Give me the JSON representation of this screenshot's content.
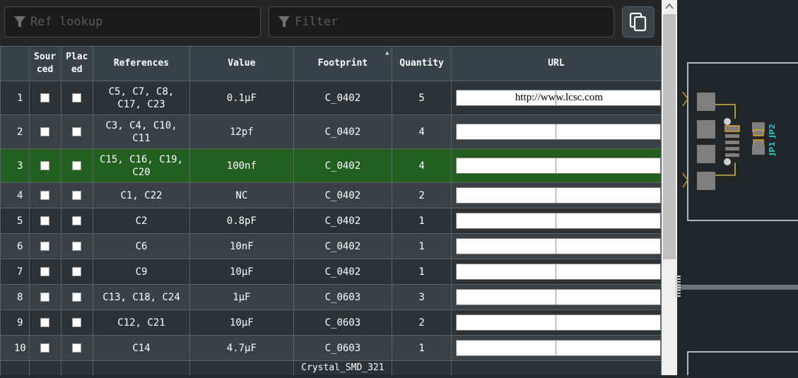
{
  "filters": {
    "ref_lookup_placeholder": "Ref lookup",
    "filter_placeholder": "Filter"
  },
  "toolbar": {
    "copy_icon": "copy-icon",
    "filter_icon": "funnel-icon"
  },
  "table": {
    "columns": [
      "",
      "Sourced",
      "Placed",
      "References",
      "Value",
      "Footprint",
      "Quantity",
      "URL"
    ],
    "header_labels": {
      "sourced": "Sour\nced",
      "placed": "Plac\ned",
      "references": "References",
      "value": "Value",
      "footprint": "Footprint",
      "quantity": "Quantity",
      "url": "URL"
    },
    "sorted_column": "Footprint",
    "rows": [
      {
        "num": "1",
        "refs": "C5, C7, C8,\nC17, C23",
        "value": "0.1µF",
        "footprint": "C_0402",
        "qty": "5",
        "url": "http://www.lcsc.com",
        "sourced": false,
        "placed": false
      },
      {
        "num": "2",
        "refs": "C3, C4, C10,\nC11",
        "value": "12pf",
        "footprint": "C_0402",
        "qty": "4",
        "url": "",
        "sourced": false,
        "placed": false
      },
      {
        "num": "3",
        "refs": "C15, C16, C19,\nC20",
        "value": "100nf",
        "footprint": "C_0402",
        "qty": "4",
        "url": "",
        "sourced": false,
        "placed": false,
        "highlighted": true
      },
      {
        "num": "4",
        "refs": "C1, C22",
        "value": "NC",
        "footprint": "C_0402",
        "qty": "2",
        "url": "",
        "sourced": false,
        "placed": false
      },
      {
        "num": "5",
        "refs": "C2",
        "value": "0.8pF",
        "footprint": "C_0402",
        "qty": "1",
        "url": "",
        "sourced": false,
        "placed": false
      },
      {
        "num": "6",
        "refs": "C6",
        "value": "10nF",
        "footprint": "C_0402",
        "qty": "1",
        "url": "",
        "sourced": false,
        "placed": false
      },
      {
        "num": "7",
        "refs": "C9",
        "value": "10µF",
        "footprint": "C_0402",
        "qty": "1",
        "url": "",
        "sourced": false,
        "placed": false
      },
      {
        "num": "8",
        "refs": "C13, C18, C24",
        "value": "1µF",
        "footprint": "C_0603",
        "qty": "3",
        "url": "",
        "sourced": false,
        "placed": false
      },
      {
        "num": "9",
        "refs": "C12, C21",
        "value": "10µF",
        "footprint": "C_0603",
        "qty": "2",
        "url": "",
        "sourced": false,
        "placed": false
      },
      {
        "num": "10",
        "refs": "C14",
        "value": "4.7µF",
        "footprint": "C_0603",
        "qty": "1",
        "url": "",
        "sourced": false,
        "placed": false
      },
      {
        "num": "",
        "refs": "",
        "value": "",
        "footprint": "Crystal_SMD_321",
        "qty": "",
        "url": "",
        "partial": true
      }
    ]
  },
  "pcb": {
    "labels": [
      "JP1",
      "JP2"
    ],
    "colors": {
      "background": "#232628",
      "outline": "#e8e8e8",
      "pad": "#7f7f7f",
      "trace": "#b8a53a",
      "pad_highlight": "#e0a028",
      "silkscreen": "#2fb8b8"
    }
  },
  "colors": {
    "row_highlight": "#225f21",
    "header_bg": "#394347",
    "row_bg": "#2f3234",
    "row_alt_bg": "#3a4043"
  }
}
